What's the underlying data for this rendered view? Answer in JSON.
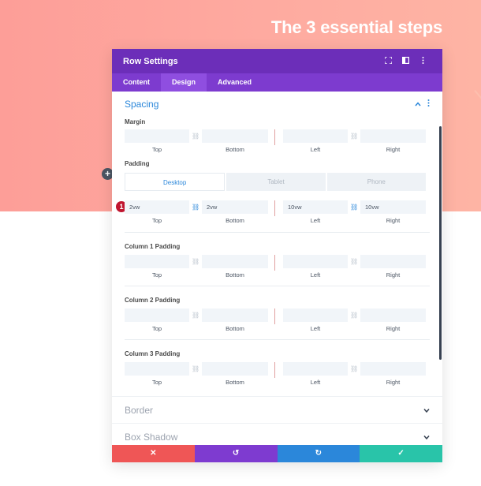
{
  "hero": {
    "title": "The 3 essential steps"
  },
  "builder": {
    "add_label": "+"
  },
  "modal": {
    "title": "Row Settings",
    "header_icons": [
      "expand-icon",
      "split-view-icon",
      "more-options-icon"
    ],
    "tabs": [
      "Content",
      "Design",
      "Advanced"
    ],
    "active_tab": "Design"
  },
  "spacing": {
    "title": "Spacing",
    "margin": {
      "label": "Margin",
      "top": "",
      "bottom": "",
      "left": "",
      "right": ""
    },
    "padding": {
      "label": "Padding",
      "devices": [
        "Desktop",
        "Tablet",
        "Phone"
      ],
      "active_device": "Desktop",
      "top": "2vw",
      "bottom": "2vw",
      "left": "10vw",
      "right": "10vw",
      "step_number": "1"
    },
    "column1": {
      "label": "Column 1 Padding"
    },
    "column2": {
      "label": "Column 2 Padding"
    },
    "column3": {
      "label": "Column 3 Padding"
    },
    "captions": {
      "top": "Top",
      "bottom": "Bottom",
      "left": "Left",
      "right": "Right"
    }
  },
  "sections": {
    "border": "Border",
    "box_shadow": "Box Shadow"
  },
  "footer": {
    "cancel": "✕",
    "undo": "↺",
    "redo": "↻",
    "save": "✓",
    "colors": {
      "cancel": "#ef5656",
      "undo": "#7e3bd0",
      "redo": "#2b87da",
      "save": "#29c4a9"
    }
  }
}
